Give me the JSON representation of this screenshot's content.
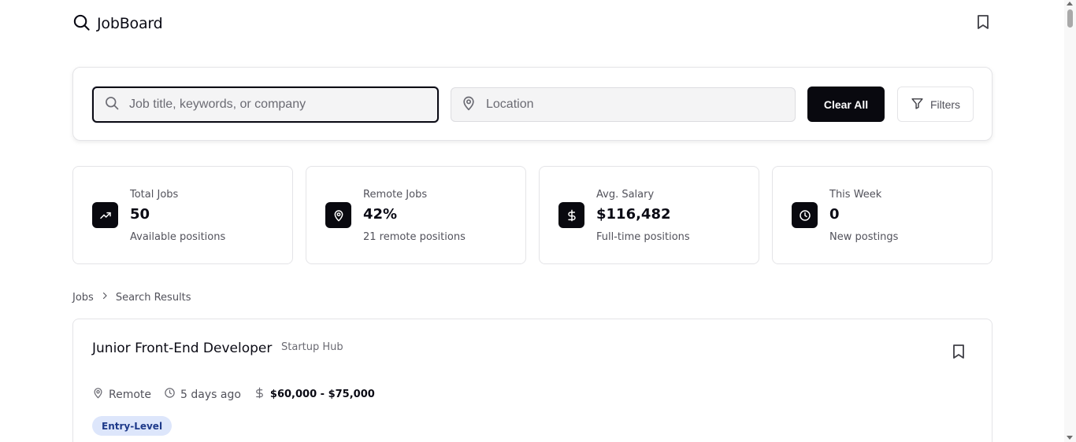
{
  "header": {
    "app_title": "JobBoard",
    "logo_icon": "search-icon",
    "bookmark_icon": "bookmark-icon"
  },
  "search": {
    "keyword_placeholder": "Job title, keywords, or company",
    "keyword_value": "",
    "location_placeholder": "Location",
    "location_value": "",
    "clear_label": "Clear All",
    "filters_label": "Filters"
  },
  "stats": [
    {
      "icon": "trending-up-icon",
      "label": "Total Jobs",
      "value": "50",
      "sub": "Available positions"
    },
    {
      "icon": "map-pin-icon",
      "label": "Remote Jobs",
      "value": "42%",
      "sub": "21 remote positions"
    },
    {
      "icon": "dollar-icon",
      "label": "Avg. Salary",
      "value": "$116,482",
      "sub": "Full-time positions"
    },
    {
      "icon": "clock-icon",
      "label": "This Week",
      "value": "0",
      "sub": "New postings"
    }
  ],
  "breadcrumb": {
    "root": "Jobs",
    "current": "Search Results"
  },
  "jobs": [
    {
      "title": "Junior Front-End Developer",
      "company": "Startup Hub",
      "location": "Remote",
      "posted": "5 days ago",
      "salary": "$60,000 - $75,000",
      "tag": "Entry-Level"
    }
  ],
  "colors": {
    "primary": "#09090f",
    "border": "#e4e4e7",
    "muted_text": "#52525b",
    "tag_bg": "#dde6fb",
    "tag_text": "#1e3a8a"
  }
}
